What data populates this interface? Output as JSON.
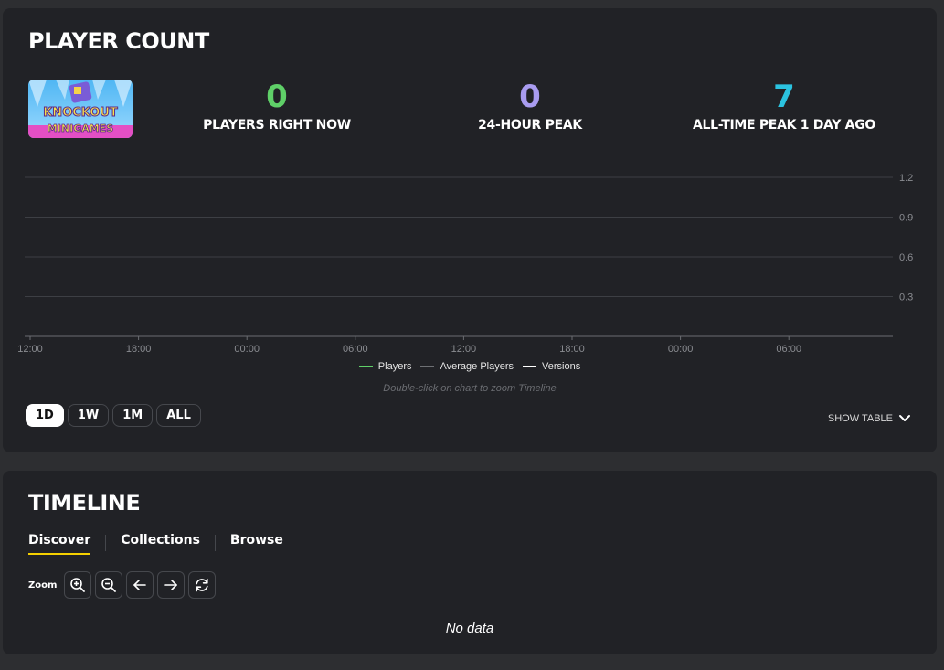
{
  "player_count": {
    "title": "PLAYER COUNT",
    "thumbnail": {
      "alt": "Knockout Minigame map thumbnail",
      "text_line1": "KNOCKOUT",
      "text_line2": "MINIGAMES"
    },
    "stats": [
      {
        "value": "0",
        "label": "PLAYERS RIGHT NOW",
        "color": "#5fd068"
      },
      {
        "value": "0",
        "label": "24-HOUR PEAK",
        "color": "#a99cf0"
      },
      {
        "value": "7",
        "label": "ALL-TIME PEAK 1 DAY AGO",
        "color": "#2bc3e0"
      }
    ],
    "legend": [
      {
        "label": "Players",
        "color": "#5fd068"
      },
      {
        "label": "Average Players",
        "color": "#6e7074"
      },
      {
        "label": "Versions",
        "color": "#ffffff"
      }
    ],
    "hint": "Double-click on chart to zoom Timeline",
    "ranges": [
      {
        "label": "1D",
        "active": true
      },
      {
        "label": "1W",
        "active": false
      },
      {
        "label": "1M",
        "active": false
      },
      {
        "label": "ALL",
        "active": false
      }
    ],
    "show_table_label": "SHOW TABLE"
  },
  "chart_data": {
    "type": "line",
    "x_ticks": [
      "12:00",
      "18:00",
      "00:00",
      "06:00",
      "12:00",
      "18:00",
      "00:00",
      "06:00"
    ],
    "y_ticks": [
      "1.2",
      "0.9",
      "0.6",
      "0.3"
    ],
    "ylim": [
      0,
      1.2
    ],
    "grid": true,
    "legend_position": "bottom",
    "series": [
      {
        "name": "Players",
        "values": []
      },
      {
        "name": "Average Players",
        "values": []
      },
      {
        "name": "Versions",
        "values": []
      }
    ]
  },
  "timeline": {
    "title": "TIMELINE",
    "tabs": [
      {
        "label": "Discover",
        "active": true
      },
      {
        "label": "Collections",
        "active": false
      },
      {
        "label": "Browse",
        "active": false
      }
    ],
    "zoom_label": "Zoom",
    "zoom_buttons": [
      "zoom-in-icon",
      "zoom-out-icon",
      "arrow-left-icon",
      "arrow-right-icon",
      "refresh-icon"
    ],
    "empty_text": "No data"
  }
}
